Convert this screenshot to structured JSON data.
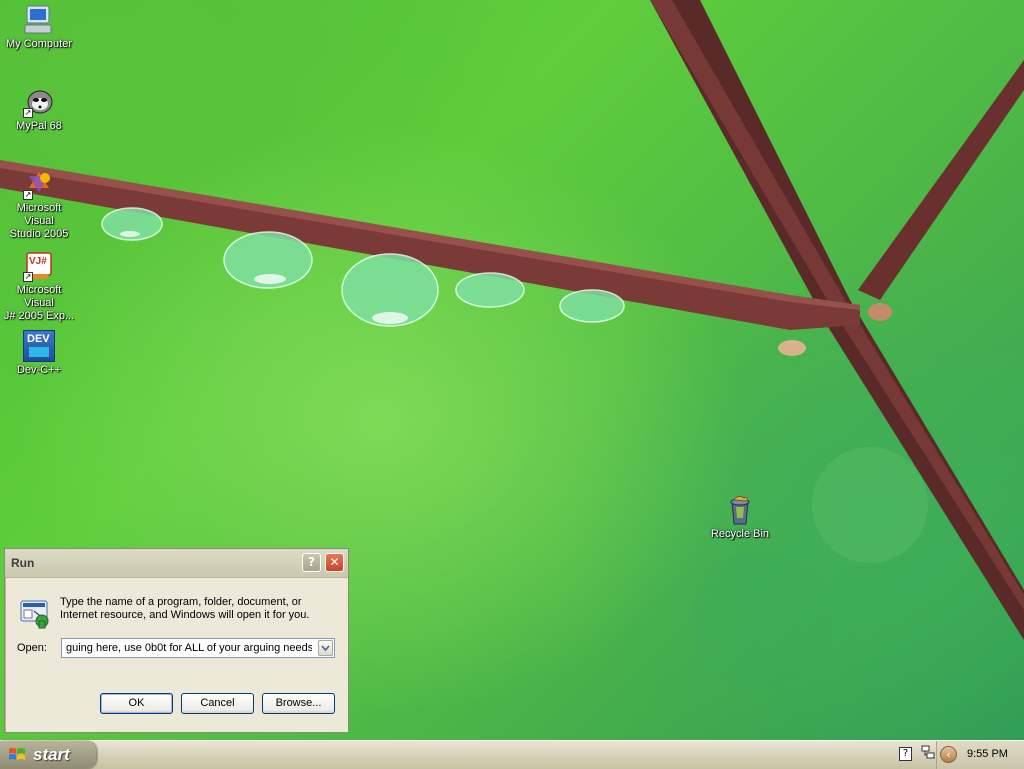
{
  "desktop": {
    "icons": [
      {
        "label": "My Computer"
      },
      {
        "label": "MyPal 68"
      },
      {
        "label": "Microsoft Visual\nStudio 2005"
      },
      {
        "label": "Microsoft Visual\nJ# 2005 Exp..."
      },
      {
        "label": "Dev-C++"
      },
      {
        "label": "Recycle Bin"
      }
    ],
    "dev_icon_text": "DEV",
    "vj_icon_text": "VJ#"
  },
  "run_dialog": {
    "title": "Run",
    "help_glyph": "?",
    "close_glyph": "✕",
    "description": "Type the name of a program, folder, document, or Internet resource, and Windows will open it for you.",
    "open_label": "Open:",
    "open_value": "guing here, use 0b0t for ALL of your arguing needs",
    "ok_label": "OK",
    "cancel_label": "Cancel",
    "browse_label": "Browse..."
  },
  "taskbar": {
    "start_label": "start",
    "help_icon_glyph": "?",
    "expand_glyph": "‹",
    "clock": "9:55 PM"
  },
  "colors": {
    "wallpaper_green": "#5fcd3c",
    "branch": "#7a3a38",
    "taskbar": "#d7d2b9",
    "dialog_face": "#ece9d8",
    "close_red": "#c8452a"
  }
}
